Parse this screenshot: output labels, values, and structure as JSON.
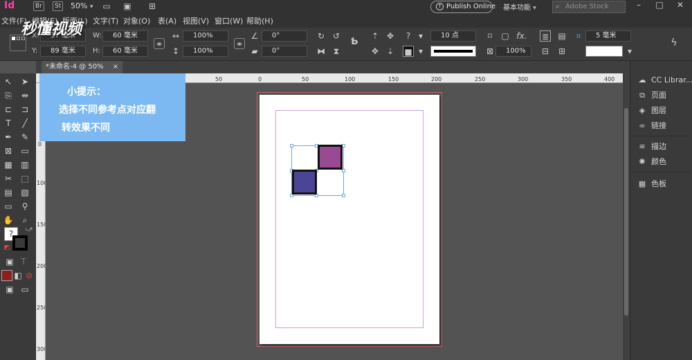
{
  "menubar": {
    "app_logo": "Id",
    "bridge": "Br",
    "stock": "St",
    "zoom": "50%",
    "menus": [
      "文件(F)",
      "编辑(E)",
      "版面(L)",
      "文字(T)",
      "对象(O)",
      "表(A)",
      "视图(V)",
      "窗口(W)",
      "帮助(H)"
    ],
    "publish_label": "Publish Online",
    "workspace": "基本功能",
    "search_placeholder": "Adobe Stock"
  },
  "control": {
    "x_label": "X:",
    "x_value": "37 毫米",
    "y_label": "Y:",
    "y_value": "89 毫米",
    "w_label": "W:",
    "w_value": "60 毫米",
    "h_label": "H:",
    "h_value": "60 毫米",
    "scale_x": "100%",
    "scale_y": "100%",
    "rotate": "0°",
    "shear": "0°",
    "stroke_weight": "10 点",
    "opacity": "100%",
    "corner": "5 毫米"
  },
  "tab": {
    "title": "*未命名-4 @ 50%",
    "close": "×"
  },
  "ruler": {
    "h_ticks": [
      "50",
      "0",
      "50",
      "100",
      "150",
      "200",
      "250",
      "300",
      "350",
      "400"
    ],
    "v_ticks": [
      "0",
      "100",
      "150",
      "200",
      "250",
      "300"
    ]
  },
  "tip": {
    "title": "小提示：",
    "line1": "选择不同参考点对应翻",
    "line2": "转效果不同"
  },
  "shapes": {
    "square1_color": "#9a4a94",
    "square2_color": "#4b4595"
  },
  "rpanel": {
    "items": [
      "CC Librar...",
      "页面",
      "图层",
      "链接",
      "描边",
      "颜色",
      "色板"
    ]
  },
  "watermark": "秒懂视频"
}
